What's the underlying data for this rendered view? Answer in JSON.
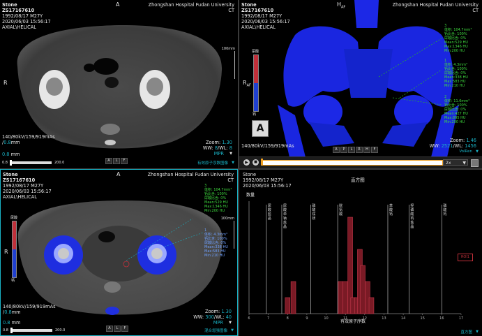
{
  "patient": {
    "name": "Stone",
    "id": "ZS17167610",
    "dob": "1992/08/17 M27Y",
    "datetime": "2020/06/03 15:56:17",
    "series": "AXIAL\\HELICAL",
    "hospital": "Zhongshan Hospital Fudan University",
    "modality": "CT"
  },
  "viewports": {
    "top_left": {
      "orientation_top": "A",
      "orientation_left": "R",
      "scale_label": "100mm",
      "acq_params": "140/80kV/159/919mAs",
      "thickness_value": "0.8",
      "thickness_unit": "mm",
      "zoom_label": "Zoom:",
      "zoom_value": "1.30",
      "ww_label": "WW:",
      "ww_value": "8",
      "wl_label": "/WL:",
      "wl_value": "8",
      "mode": "MPR",
      "slider_min": "0.8",
      "slider_max": "200.0",
      "orient_buttons": [
        "A",
        "L",
        "F"
      ],
      "footer_link": "有效原子序数图像"
    },
    "top_right": {
      "orientation_top": "H",
      "orientation_top2": "AF",
      "orientation_left": "R",
      "orientation_left2": "AF",
      "colorbar_top": "尿酸",
      "colorbar_bottom": "钙",
      "orient_cube_label": "A",
      "acq_params": "140/80kV/159/919mAs",
      "view_buttons": [
        "A",
        "P",
        "L",
        "R",
        "H",
        "F"
      ],
      "zoom_label": "Zoom:",
      "zoom_value": "1.46",
      "ww_label": "WW:",
      "ww_value": "2521",
      "wl_label": "/WL:",
      "wl_value": "1456",
      "vr_label": "VolRen",
      "play_speed": "2x",
      "roi1": [
        "3",
        "体积: 104.7mm³",
        "钙比含: 100%",
        "尿酸比含: 0%",
        "Mean:529 HU",
        "Max:1346 HU",
        "Min:200 HU"
      ],
      "roi2": [
        "1",
        "体积: 4.3mm³",
        "钙比含: 100%",
        "尿酸比含: 0%",
        "Mean:338 HU",
        "Max:583 HU",
        "Min:210 HU"
      ],
      "roi3": [
        "2",
        "体积: 11.6mm³",
        "钙比含: 100%",
        "尿酸比含: 0%",
        "Mean:427 HU",
        "Max:895 HU",
        "Min:200 HU"
      ]
    },
    "bottom_left": {
      "orientation_top": "A",
      "orientation_left": "R",
      "colorbar_top": "尿酸",
      "colorbar_bottom": "钙",
      "scale_label": "100mm",
      "acq_params": "140/80kV/159/919mAs",
      "thickness_value": "0.8",
      "thickness_unit": "mm",
      "zoom_label": "Zoom:",
      "zoom_value": "1.30",
      "ww_label": "WW:",
      "ww_value": "300",
      "wl_label": "/WL:",
      "wl_value": "40",
      "mode": "MPR",
      "slider_min": "0.8",
      "slider_max": "200.0",
      "orient_buttons": [
        "A",
        "L",
        "F"
      ],
      "footer_link": "混合增强图像",
      "roi1": [
        "3",
        "体积: 104.7mm³",
        "钙比含: 100%",
        "尿酸比含: 0%",
        "Mean:529 HU",
        "Max:1346 HU",
        "Min:200 HU"
      ],
      "roi2": [
        "1",
        "体积: 4.3mm³",
        "钙比含: 100%",
        "尿酸比含: 0%",
        "Mean:338 HU",
        "Max:583 HU",
        "Min:210 HU"
      ]
    },
    "bottom_right": {
      "title": "直方图",
      "ylabel": "数量",
      "xlabel": "有效原子序数",
      "roi_tag": "ROI1",
      "footer_link": "直方图",
      "ref_labels": [
        "尿酸盐晶",
        "尿酸单钠盐晶",
        "磷酸铵镁",
        "胱氨酸",
        "草酸钙",
        "羟磷酸钙盐晶",
        "磷酸钙"
      ]
    }
  },
  "chart_data": {
    "type": "bar",
    "title": "直方图",
    "xlabel": "有效原子序数",
    "ylabel": "数量",
    "xlim": [
      6,
      17
    ],
    "ylim": [
      0,
      7
    ],
    "x_ticks": [
      6,
      7,
      8,
      9,
      10,
      11,
      12,
      13,
      14,
      15,
      16,
      17
    ],
    "bars": [
      {
        "x": 8.0,
        "value": 1
      },
      {
        "x": 8.3,
        "value": 2
      },
      {
        "x": 10.75,
        "value": 2
      },
      {
        "x": 11.0,
        "value": 2
      },
      {
        "x": 11.25,
        "value": 6
      },
      {
        "x": 11.4,
        "value": 1
      },
      {
        "x": 11.6,
        "value": 1
      },
      {
        "x": 11.75,
        "value": 4
      },
      {
        "x": 11.9,
        "value": 3
      },
      {
        "x": 12.15,
        "value": 2
      },
      {
        "x": 12.35,
        "value": 1
      }
    ],
    "reference_lines": [
      {
        "x": 6.9,
        "label": "尿酸盐晶"
      },
      {
        "x": 7.7,
        "label": "尿酸单钠盐晶"
      },
      {
        "x": 9.2,
        "label": "磷酸铵镁"
      },
      {
        "x": 10.6,
        "label": "胱氨酸"
      },
      {
        "x": 13.2,
        "label": "草酸钙"
      },
      {
        "x": 14.3,
        "label": "羟磷酸钙盐晶"
      },
      {
        "x": 16.0,
        "label": "磷酸钙"
      }
    ]
  },
  "colors": {
    "accent": "#19b3c6",
    "roi_text": "#3fdc3f",
    "bone_render": "#1c28e6",
    "bar_fill": "#7a1a25",
    "bar_edge": "#c2384a",
    "uric_acid": "#c0303a",
    "calcium": "#2040d0"
  }
}
